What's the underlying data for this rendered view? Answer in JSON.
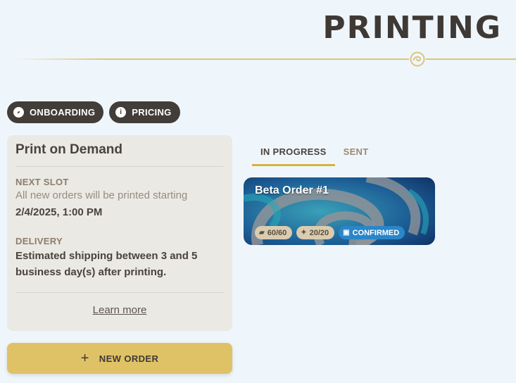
{
  "page": {
    "title": "PRINTING"
  },
  "pills": [
    {
      "label": "ONBOARDING",
      "icon": "compass-icon"
    },
    {
      "label": "PRICING",
      "icon": "info-icon"
    }
  ],
  "info_card": {
    "title": "Print on Demand",
    "next_slot_label": "NEXT SLOT",
    "next_slot_text": "All new orders will be printed starting",
    "next_slot_date": "2/4/2025, 1:00 PM",
    "delivery_label": "DELIVERY",
    "delivery_line1": "Estimated shipping between 3 and 5",
    "delivery_line2": "business day(s) after printing.",
    "learn_more": "Learn more"
  },
  "new_order": {
    "label": "NEW ORDER",
    "icon": "plus-icon"
  },
  "tabs": [
    {
      "label": "IN PROGRESS",
      "active": true
    },
    {
      "label": "SENT",
      "active": false
    }
  ],
  "order": {
    "title": "Beta Order #1",
    "cards_count": "60/60",
    "cards_icon": "cards-icon",
    "sparkle_count": "20/20",
    "sparkle_icon": "sparkle-icon",
    "status": "CONFIRMED",
    "status_icon": "confirmed-icon"
  },
  "colors": {
    "background": "#eff6fb",
    "accent": "#e0c266",
    "pill": "#433d39",
    "status": "#2a86c8"
  }
}
